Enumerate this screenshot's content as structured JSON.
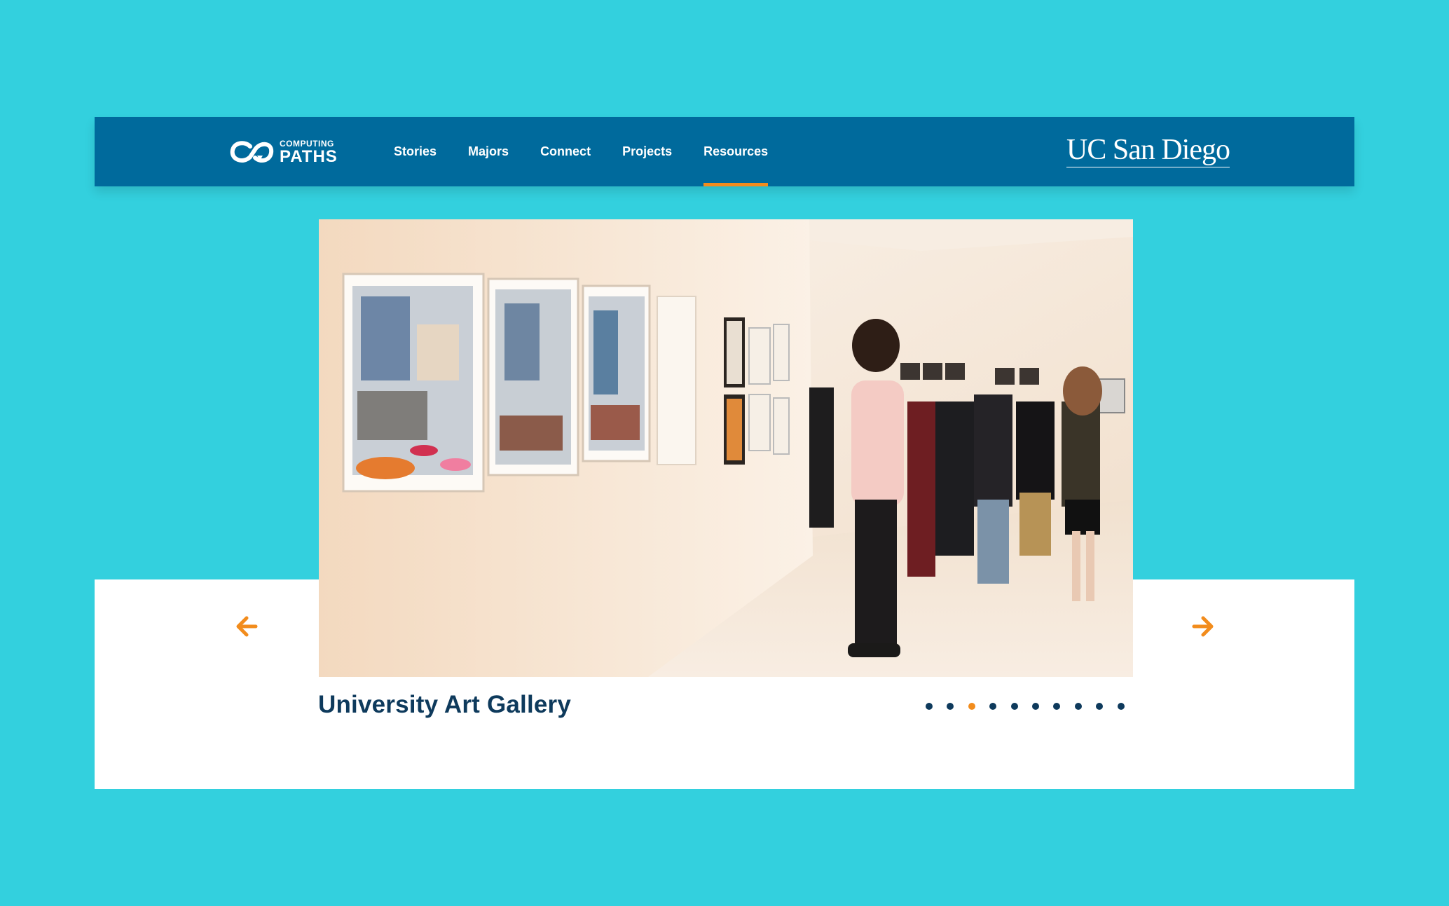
{
  "header": {
    "logo": {
      "top_text": "COMPUTING",
      "bottom_text": "PATHS"
    },
    "nav": [
      {
        "label": "Stories"
      },
      {
        "label": "Majors"
      },
      {
        "label": "Connect"
      },
      {
        "label": "Projects"
      },
      {
        "label": "Resources",
        "active": true
      }
    ],
    "university": "UC San Diego"
  },
  "carousel": {
    "caption": "University Art Gallery",
    "slide_count": 10,
    "active_slide": 3,
    "prev_icon": "arrow-left-icon",
    "next_icon": "arrow-right-icon"
  },
  "colors": {
    "background": "#33d0de",
    "header": "#006a9c",
    "accent": "#f28c1c",
    "text_dark": "#0e3a5c",
    "panel": "#ffffff"
  }
}
